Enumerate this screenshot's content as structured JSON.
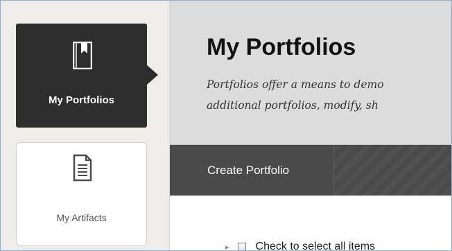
{
  "nav": {
    "items": [
      {
        "label": "My Portfolios",
        "icon": "bookmark-book-icon",
        "active": true
      },
      {
        "label": "My Artifacts",
        "icon": "document-icon",
        "active": false
      }
    ]
  },
  "header": {
    "title": "My Portfolios",
    "description_lines": [
      "Portfolios offer a means to demo",
      "additional portfolios, modify, sh"
    ]
  },
  "toolbar": {
    "create_label": "Create Portfolio"
  },
  "list": {
    "select_all_label": "Check to select all items"
  },
  "colors": {
    "active_tile": "#2d2d2d",
    "header_bg": "#dcdcdc",
    "action_bar": "#4a4a4a",
    "rail_bg": "#efedea"
  }
}
